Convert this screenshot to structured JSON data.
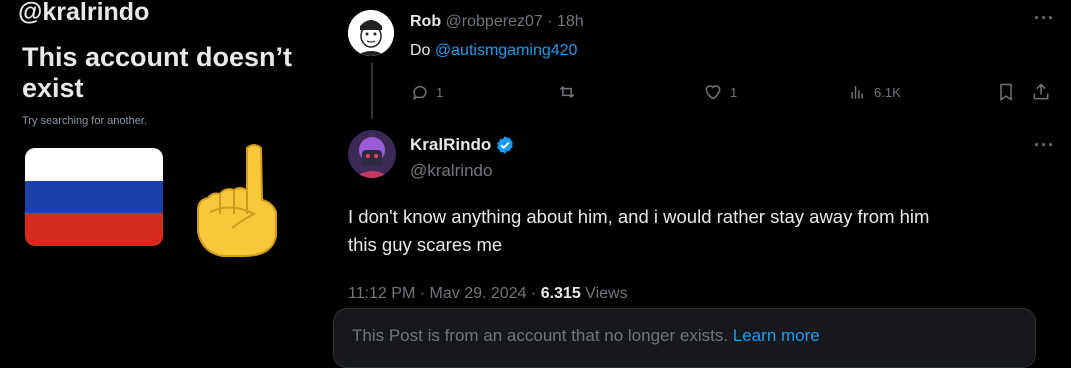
{
  "left_panel": {
    "handle": "@kralrindo",
    "title": "This account doesn’t exist",
    "hint": "Try searching for another.",
    "flag_colors": [
      "#ffffff",
      "#1c3fa8",
      "#d52b1e"
    ],
    "emoji": "middle-finger-icon"
  },
  "reply_tweet": {
    "name": "Rob",
    "handle": "@robperez07",
    "separator": "·",
    "time": "18h",
    "text_prefix": "Do ",
    "mention": "@autismgaming420",
    "replies": "1",
    "retweets": "",
    "likes": "1",
    "views": "6.1K"
  },
  "main_tweet": {
    "name": "KralRindo",
    "handle": "@kralrindo",
    "text_line1": "I don't know anything about him, and i would rather stay away from him",
    "text_line2": "this guy scares me",
    "timestamp": "11:12 PM · Mav 29. 2024 · ",
    "views_count": "6.315",
    "views_label": " Views"
  },
  "notice": {
    "text": "This Post is from an account that no longer exists. ",
    "link": "Learn more"
  },
  "colors": {
    "accent": "#1d9bf0",
    "muted": "#71767b",
    "text": "#e7e9ea"
  }
}
